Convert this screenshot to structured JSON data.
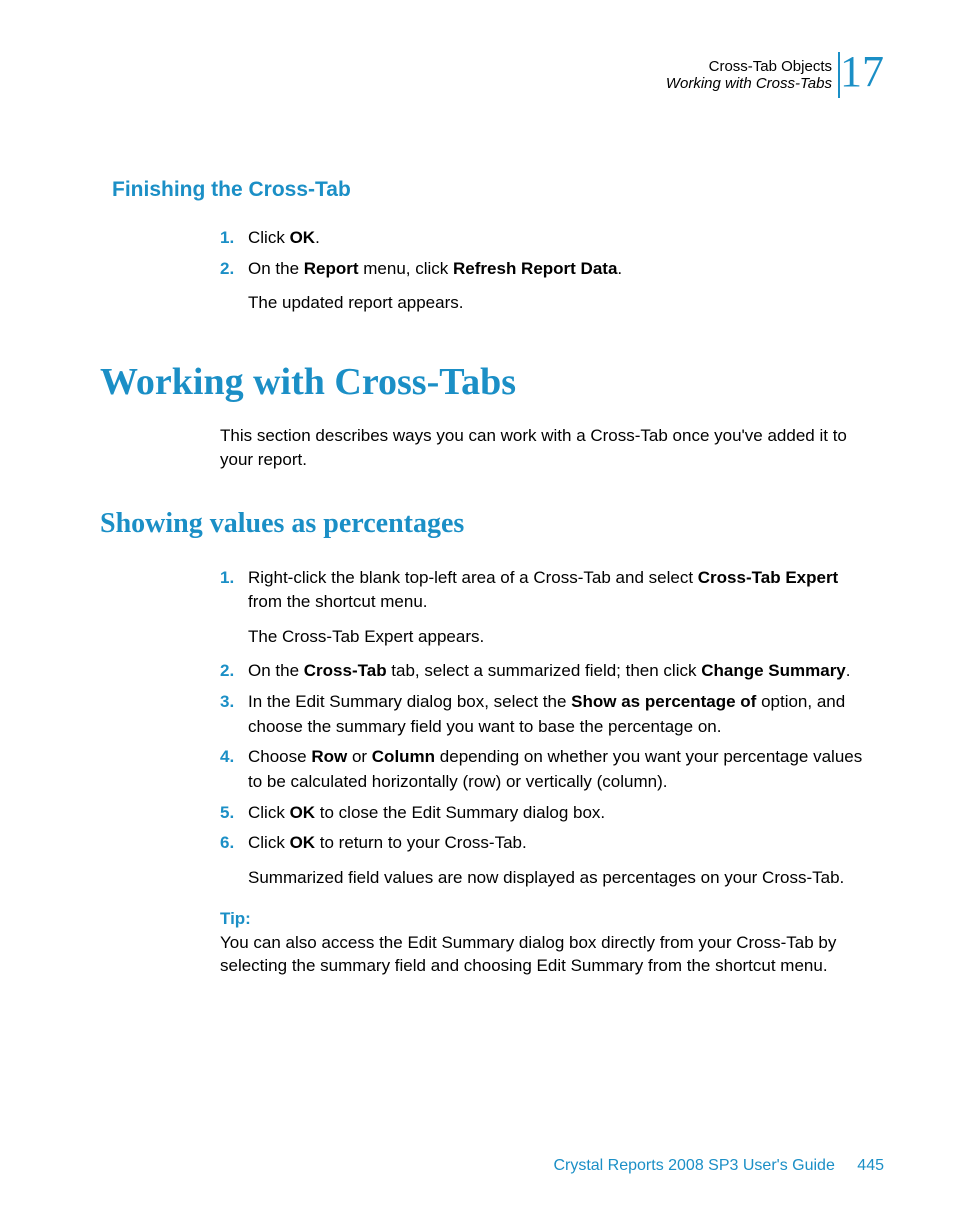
{
  "header": {
    "chapter_title": "Cross-Tab Objects",
    "section_title": "Working with Cross-Tabs",
    "chapter_number": "17"
  },
  "h3_finishing": "Finishing the Cross-Tab",
  "finishing_steps": {
    "s1_num": "1.",
    "s1_pre": "Click ",
    "s1_bold": "OK",
    "s1_post": ".",
    "s2_num": "2.",
    "s2_pre": "On the ",
    "s2_b1": "Report",
    "s2_mid": " menu, click ",
    "s2_b2": "Refresh Report Data",
    "s2_post": ".",
    "s2_follow": "The updated report appears."
  },
  "h1_working": "Working with Cross-Tabs",
  "intro_text": "This section describes ways you can work with a Cross-Tab once you've added it to your report.",
  "h2_showing": "Showing values as percentages",
  "pct_steps": {
    "s1_num": "1.",
    "s1_pre": "Right-click the blank top-left area of a Cross-Tab and select ",
    "s1_b1": "Cross-Tab Expert",
    "s1_post": " from the shortcut menu.",
    "s1_follow": "The Cross-Tab Expert appears.",
    "s2_num": "2.",
    "s2_pre": "On the ",
    "s2_b1": "Cross-Tab",
    "s2_mid": " tab, select a summarized field; then click ",
    "s2_b2": "Change Summary",
    "s2_post": ".",
    "s3_num": "3.",
    "s3_pre": "In the Edit Summary dialog box, select the ",
    "s3_b1": "Show as percentage of",
    "s3_post": " option, and choose the summary field you want to base the percentage on.",
    "s4_num": "4.",
    "s4_pre": "Choose ",
    "s4_b1": "Row",
    "s4_mid": " or ",
    "s4_b2": "Column",
    "s4_post": " depending on whether you want your percentage values to be calculated horizontally (row) or vertically (column).",
    "s5_num": "5.",
    "s5_pre": "Click ",
    "s5_b1": "OK",
    "s5_post": " to close the Edit Summary dialog box.",
    "s6_num": "6.",
    "s6_pre": "Click ",
    "s6_b1": "OK",
    "s6_post": " to return to your Cross-Tab.",
    "s6_follow": "Summarized field values are now displayed as percentages on your Cross-Tab."
  },
  "tip": {
    "label": "Tip:",
    "text": "You can also access the Edit Summary dialog box directly from your Cross-Tab by selecting the summary field and choosing Edit Summary from the shortcut menu."
  },
  "footer": {
    "guide": "Crystal Reports 2008 SP3 User's Guide",
    "page": "445"
  }
}
